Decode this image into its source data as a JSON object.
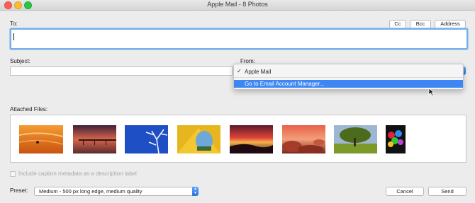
{
  "window": {
    "title": "Apple Mail - 8 Photos"
  },
  "to": {
    "label": "To:",
    "value": ""
  },
  "recipient_buttons": {
    "cc": "Cc",
    "bcc": "Bcc",
    "address": "Address"
  },
  "subject": {
    "label": "Subject:",
    "value": ""
  },
  "from": {
    "label": "From:",
    "menu": [
      {
        "label": "Apple Mail",
        "checked": true
      },
      {
        "label": "Go to Email Account Manager...",
        "highlighted": true
      }
    ]
  },
  "attached": {
    "label": "Attached Files:",
    "photos": [
      {
        "icon": "sunset-swimmer-photo"
      },
      {
        "icon": "pier-sunset-photo"
      },
      {
        "icon": "bare-tree-blue-sky-photo"
      },
      {
        "icon": "yellow-tent-photo"
      },
      {
        "icon": "red-sky-sunset-photo"
      },
      {
        "icon": "rocky-shore-sunset-photo"
      },
      {
        "icon": "oak-tree-field-photo"
      },
      {
        "icon": "balloons-photo"
      }
    ]
  },
  "caption_option": {
    "label": "Include caption metadata as a description label",
    "checked": false
  },
  "preset": {
    "label": "Preset:",
    "value": "Medium - 500 px long edge, medium quality"
  },
  "actions": {
    "cancel": "Cancel",
    "send": "Send"
  },
  "colors": {
    "accent": "#3d87f5",
    "focus_ring": "#79aee6"
  }
}
